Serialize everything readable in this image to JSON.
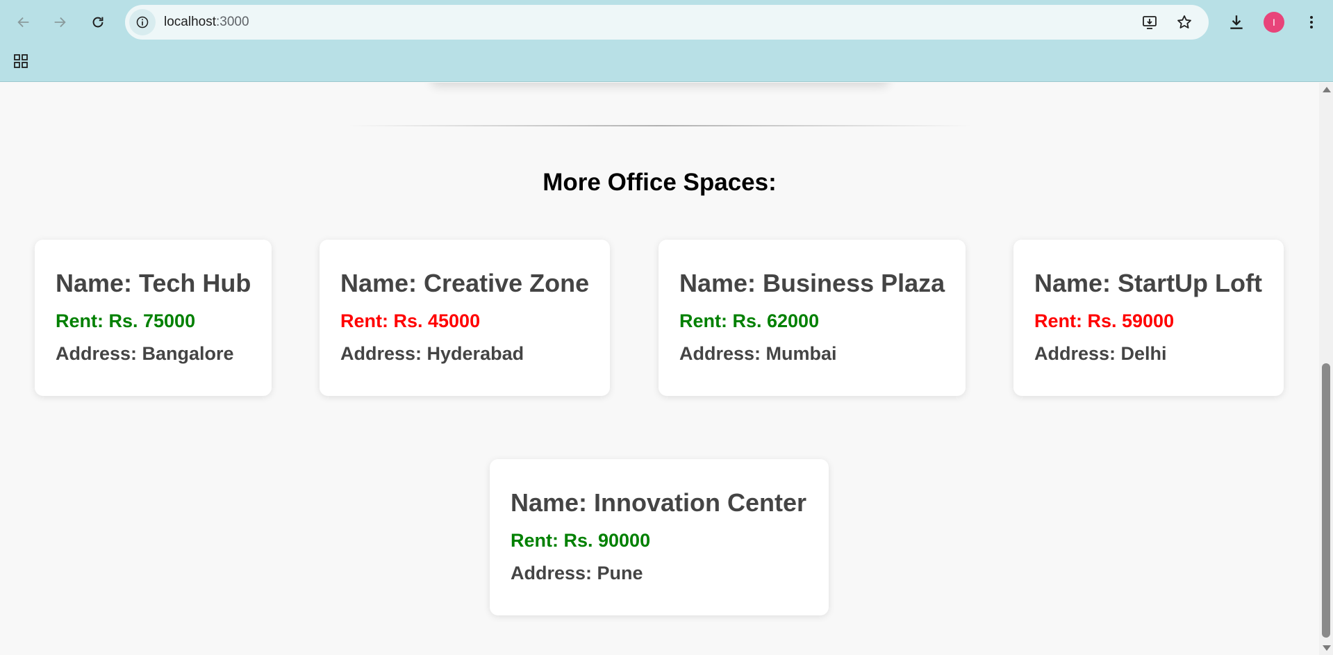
{
  "browser": {
    "url_host": "localhost",
    "url_port": ":3000",
    "profile_initial": "I"
  },
  "page": {
    "section_title": "More Office Spaces:",
    "offices": [
      {
        "name": "Name: Tech Hub",
        "rent": "Rent: Rs. 75000",
        "address": "Address: Bangalore",
        "rent_color": "#008000"
      },
      {
        "name": "Name: Creative Zone",
        "rent": "Rent: Rs. 45000",
        "address": "Address: Hyderabad",
        "rent_color": "#ff0000"
      },
      {
        "name": "Name: Business Plaza",
        "rent": "Rent: Rs. 62000",
        "address": "Address: Mumbai",
        "rent_color": "#008000"
      },
      {
        "name": "Name: StartUp Loft",
        "rent": "Rent: Rs. 59000",
        "address": "Address: Delhi",
        "rent_color": "#ff0000"
      },
      {
        "name": "Name: Innovation Center",
        "rent": "Rent: Rs. 90000",
        "address": "Address: Pune",
        "rent_color": "#008000"
      }
    ]
  },
  "colors": {
    "chrome_bg": "#b8e0e6",
    "rent_green": "#008000",
    "rent_red": "#ff0000"
  }
}
